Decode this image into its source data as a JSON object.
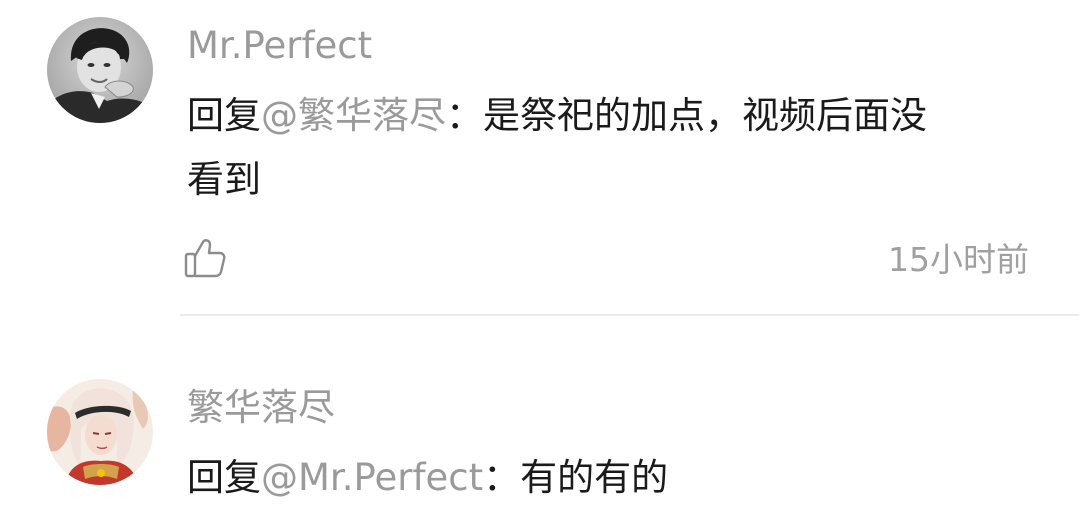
{
  "comments": [
    {
      "username": "Mr.Perfect",
      "reply_prefix": "回复",
      "mention": "@繁华落尽",
      "separator": "：",
      "text_line1": "是祭祀的加点，视频后面没",
      "text_line2": "看到",
      "timestamp": "15小时前",
      "avatar_icon": "portrait-avatar-bw",
      "like_icon": "thumbs-up-outline-icon"
    },
    {
      "username": "繁华落尽",
      "reply_prefix": "回复",
      "mention": "@Mr.Perfect",
      "separator": "：",
      "text_line1": "有的有的",
      "avatar_icon": "anime-character-avatar"
    }
  ],
  "colors": {
    "primary_text": "#1a1a1a",
    "secondary_text": "#9a9a9a",
    "divider": "#ebebeb"
  }
}
